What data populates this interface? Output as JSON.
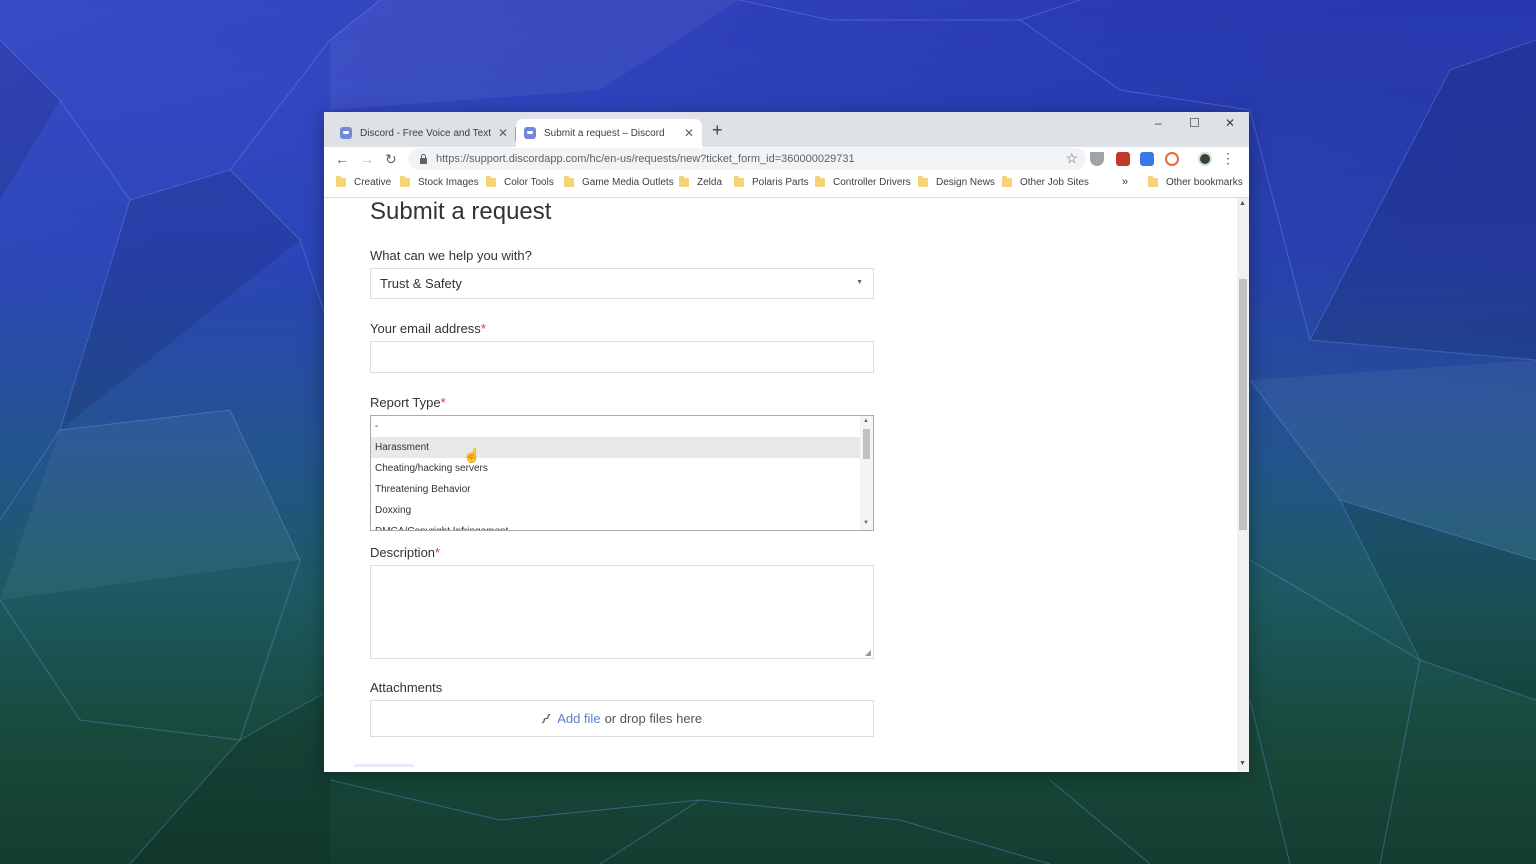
{
  "browser": {
    "tabs": [
      {
        "title": "Discord - Free Voice and Text Ch",
        "active": false
      },
      {
        "title": "Submit a request – Discord",
        "active": true
      }
    ],
    "new_tab": "+",
    "window_controls": {
      "minimize": "–",
      "maximize": "☐",
      "close": "✕"
    },
    "url": "https://support.discordapp.com/hc/en-us/requests/new?ticket_form_id=360000029731",
    "bookmarks": [
      "Creative",
      "Stock Images",
      "Color Tools",
      "Game Media Outlets",
      "Zelda",
      "Polaris Parts",
      "Controller Drivers",
      "Design News",
      "Other Job Sites"
    ],
    "bookmarks_more": "»",
    "other_bookmarks": "Other bookmarks"
  },
  "form": {
    "title": "Submit a request",
    "help_label": "What can we help you with?",
    "help_value": "Trust & Safety",
    "email_label": "Your email address",
    "report_type_label": "Report Type",
    "report_options": [
      "-",
      "Harassment",
      "Cheating/hacking servers",
      "Threatening Behavior",
      "Doxxing",
      "DMCA/Copyright Infringement"
    ],
    "description_label": "Description",
    "attachments_label": "Attachments",
    "add_file": "Add file",
    "drop_text": "or drop files here",
    "required_mark": "*"
  },
  "colors": {
    "required": "#e03a3a",
    "link": "#5b7fd6",
    "discord_favicon": "#7289da"
  }
}
